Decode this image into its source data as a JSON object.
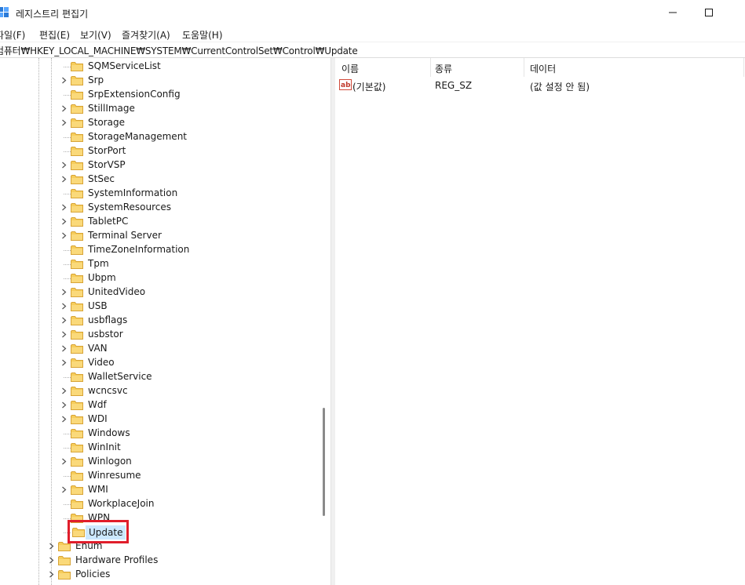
{
  "window": {
    "title": "레지스트리 편집기"
  },
  "menu": [
    "파일(F)",
    "편집(E)",
    "보기(V)",
    "즐겨찾기(A)",
    "도움말(H)"
  ],
  "address": "컴퓨터₩HKEY_LOCAL_MACHINE₩SYSTEM₩CurrentControlSet₩Control₩Update",
  "tree": {
    "control_children": [
      {
        "label": "SQMServiceList",
        "expandable": false
      },
      {
        "label": "Srp",
        "expandable": true
      },
      {
        "label": "SrpExtensionConfig",
        "expandable": false
      },
      {
        "label": "StillImage",
        "expandable": true
      },
      {
        "label": "Storage",
        "expandable": true
      },
      {
        "label": "StorageManagement",
        "expandable": false
      },
      {
        "label": "StorPort",
        "expandable": false
      },
      {
        "label": "StorVSP",
        "expandable": true
      },
      {
        "label": "StSec",
        "expandable": true
      },
      {
        "label": "SystemInformation",
        "expandable": false
      },
      {
        "label": "SystemResources",
        "expandable": true
      },
      {
        "label": "TabletPC",
        "expandable": true
      },
      {
        "label": "Terminal Server",
        "expandable": true
      },
      {
        "label": "TimeZoneInformation",
        "expandable": false
      },
      {
        "label": "Tpm",
        "expandable": false
      },
      {
        "label": "Ubpm",
        "expandable": false
      },
      {
        "label": "UnitedVideo",
        "expandable": true
      },
      {
        "label": "USB",
        "expandable": true
      },
      {
        "label": "usbflags",
        "expandable": true
      },
      {
        "label": "usbstor",
        "expandable": true
      },
      {
        "label": "VAN",
        "expandable": true
      },
      {
        "label": "Video",
        "expandable": true
      },
      {
        "label": "WalletService",
        "expandable": false
      },
      {
        "label": "wcncsvc",
        "expandable": true
      },
      {
        "label": "Wdf",
        "expandable": true
      },
      {
        "label": "WDI",
        "expandable": true
      },
      {
        "label": "Windows",
        "expandable": false
      },
      {
        "label": "WinInit",
        "expandable": false
      },
      {
        "label": "Winlogon",
        "expandable": true
      },
      {
        "label": "Winresume",
        "expandable": false
      },
      {
        "label": "WMI",
        "expandable": true
      },
      {
        "label": "WorkplaceJoin",
        "expandable": false
      },
      {
        "label": "WPN",
        "expandable": false
      }
    ],
    "selected": "Update",
    "siblings": [
      {
        "label": "Enum",
        "expandable": true
      },
      {
        "label": "Hardware Profiles",
        "expandable": true
      },
      {
        "label": "Policies",
        "expandable": true
      }
    ]
  },
  "list": {
    "columns": [
      "이름",
      "종류",
      "데이터"
    ],
    "rows": [
      {
        "icon": "string-value-icon",
        "name": "(기본값)",
        "type": "REG_SZ",
        "data": "(값 설정 안 됨)"
      }
    ]
  },
  "colors": {
    "accent": "#cce8ff",
    "highlight_border": "#e01e2b",
    "folder": "#f2c94c"
  }
}
